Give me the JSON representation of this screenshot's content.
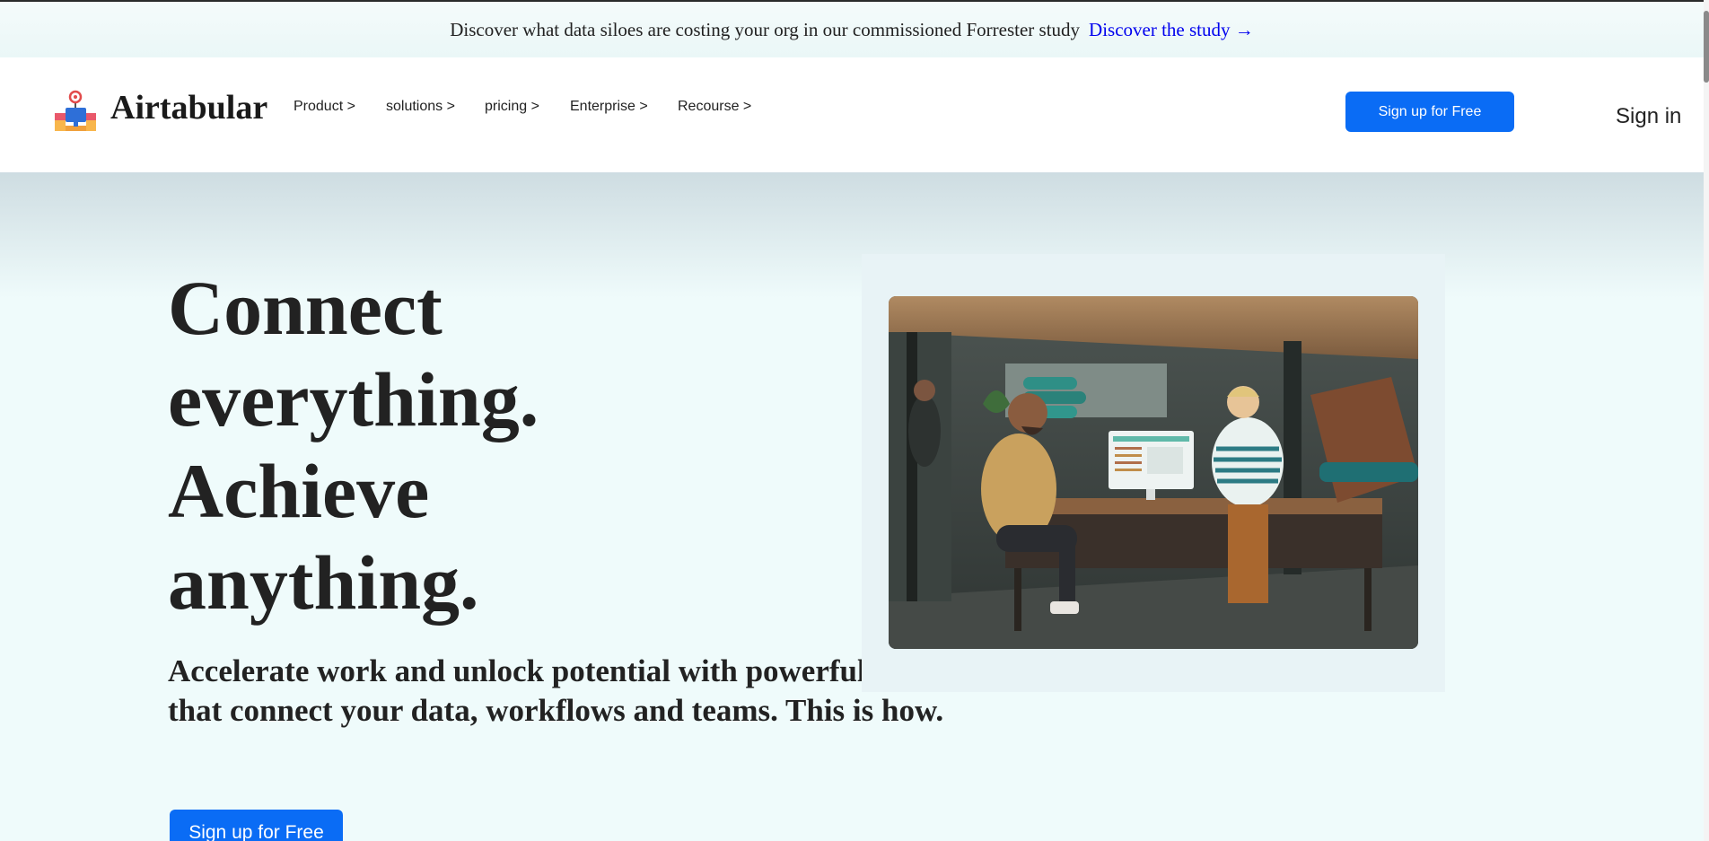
{
  "announcement": {
    "text": "Discover what data siloes are costing your org in our commissioned Forrester study",
    "link": "Discover the study →"
  },
  "nav": {
    "brand": "Airtabular",
    "items": [
      {
        "label": "Product >"
      },
      {
        "label": "solutions >"
      },
      {
        "label": "pricing >"
      },
      {
        "label": "Enterprise >"
      },
      {
        "label": "Recourse >"
      }
    ],
    "signup_label": "Sign up for Free",
    "signin_label": "Sign in"
  },
  "hero": {
    "title_lines": [
      "Connect",
      "everything.",
      "Achieve",
      "anything."
    ],
    "subtitle": "Accelerate work and unlock potential with powerful apps that connect your data, workflows and teams. This is how.",
    "cta_label": "Sign up for Free",
    "image_icon": "workshop-photo"
  },
  "colors": {
    "accent": "#0a6cf5",
    "page_background": "#effbfb",
    "link": "#0000ee"
  }
}
